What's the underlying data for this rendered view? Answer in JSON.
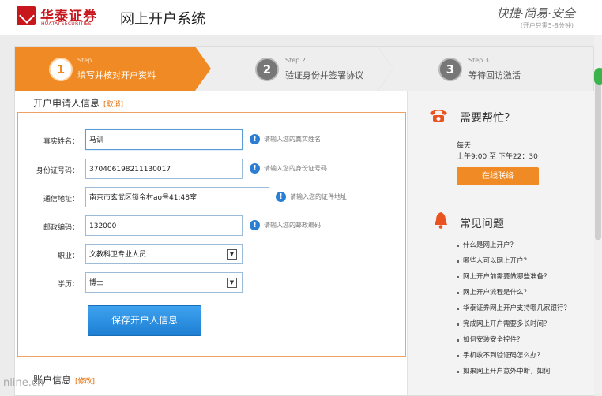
{
  "header": {
    "logo_cn": "华泰证券",
    "logo_en": "HUATAI SECURITIES",
    "system_title": "网上开户系统",
    "slogan": "快捷·简易·安全",
    "slogan_sub": "(开户只需5-8分钟)"
  },
  "steps": [
    {
      "num": "1",
      "kicker": "Step 1",
      "title": "填写并核对开户资料",
      "active": true
    },
    {
      "num": "2",
      "kicker": "Step 2",
      "title": "验证身份并签署协议",
      "active": false
    },
    {
      "num": "3",
      "kicker": "Step 3",
      "title": "等待回访激活",
      "active": false
    }
  ],
  "form": {
    "section_title": "开户申请人信息",
    "cancel_link": "[取消]",
    "fields": [
      {
        "label": "真实姓名：",
        "value": "马训",
        "hint": "请输入您的真实姓名"
      },
      {
        "label": "身份证号码：",
        "value": "370406198211130017",
        "hint": "请输入您的身份证号码"
      },
      {
        "label": "通信地址：",
        "value": "南京市玄武区锁金村ao号41:48室",
        "hint": "请输入您的证件地址"
      },
      {
        "label": "邮政编码：",
        "value": "132000",
        "hint": "请输入您的邮政编码"
      },
      {
        "label": "职业：",
        "value": "文教科卫专业人员"
      },
      {
        "label": "学历：",
        "value": "博士"
      }
    ],
    "save_label": "保存开户人信息"
  },
  "account": {
    "title": "账户信息",
    "edit_link": "[修改]"
  },
  "sidebar": {
    "help_title": "需要帮忙？",
    "days": "每天",
    "hours": "上午9:00 至 下午22：30",
    "contact_label": "在线联络",
    "faq_title": "常见问题",
    "faq": [
      "什么是网上开户？",
      "哪些人可以网上开户？",
      "网上开户前需要做哪些准备？",
      "网上开户流程是什么？",
      "华泰证券网上开户支持哪几家银行？",
      "完成网上开户需要多长时间？",
      "如何安装安全控件？",
      "手机收不到验证码怎么办？",
      "如果网上开户意外中断，如何"
    ]
  },
  "watermark": "nline.cn",
  "colors": {
    "accent": "#f08a24",
    "brand": "#c8161d",
    "button_blue": "#1e7fd3"
  }
}
